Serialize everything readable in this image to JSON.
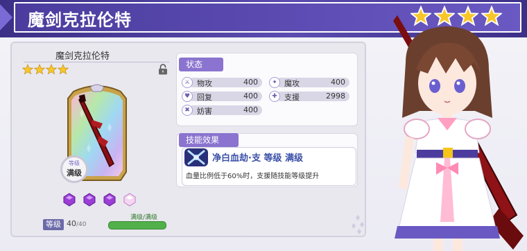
{
  "header": {
    "title": "魔剑克拉伦特",
    "rarity_stars": 4
  },
  "card": {
    "weapon_name": "魔剑克拉伦特",
    "stars": 4,
    "level_badge_small": "等级",
    "level_badge_big": "满级",
    "gems_count": 4,
    "level_label": "等级",
    "level_value": "40",
    "level_max": "/40",
    "level_bar_label": "满级/满级"
  },
  "stats": {
    "section_label": "状态",
    "items": [
      {
        "label": "物攻",
        "value": "400",
        "icon": "sword-icon"
      },
      {
        "label": "魔攻",
        "value": "400",
        "icon": "wand-icon"
      },
      {
        "label": "回复",
        "value": "400",
        "icon": "heal-icon"
      },
      {
        "label": "支援",
        "value": "2998",
        "icon": "support-icon"
      },
      {
        "label": "妨害",
        "value": "400",
        "icon": "hinder-icon"
      }
    ]
  },
  "skill": {
    "section_label": "技能效果",
    "title": "净白血劫·支  等级 满级",
    "description": "血量比例低于60%时，支援随技能等级提升"
  },
  "colors": {
    "header_bg": "#4b3c9e",
    "accent": "#8a74cf",
    "star": "#f5c518",
    "level_bar": "#52b04a"
  }
}
